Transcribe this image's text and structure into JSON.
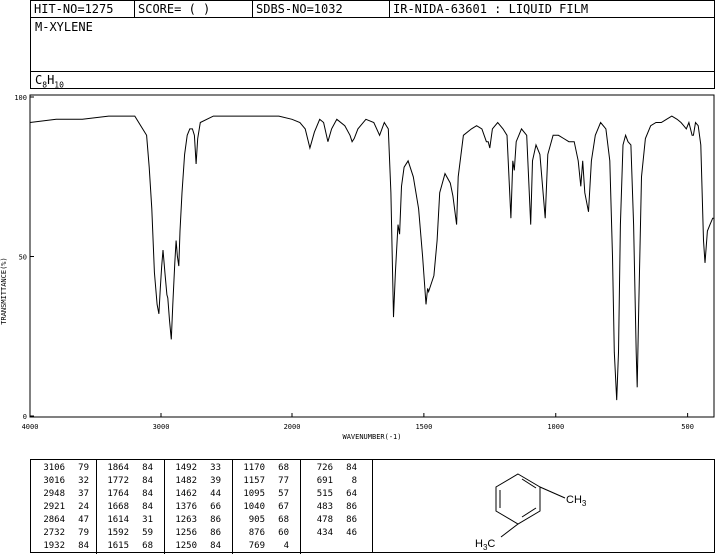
{
  "header": {
    "hit_no": "HIT-NO=1275",
    "score": "SCORE=  (   )",
    "sdbs_no": "SDBS-NO=1032",
    "ir_info": "IR-NIDA-63601 : LIQUID FILM"
  },
  "compound": {
    "name": "M-XYLENE",
    "formula_prefix_c": "C",
    "formula_c_count": "8",
    "formula_h": "H",
    "formula_h_count": "10"
  },
  "structure": {
    "ch3_top": "CH",
    "ch3_top_sub": "3",
    "ch3_bottom_h": "H",
    "ch3_bottom_sub": "3",
    "ch3_bottom_c": "C"
  },
  "peak_table": [
    [
      [
        "3106",
        "79"
      ],
      [
        "3016",
        "32"
      ],
      [
        "2948",
        "37"
      ],
      [
        "2921",
        "24"
      ],
      [
        "2864",
        "47"
      ],
      [
        "2732",
        "79"
      ],
      [
        "1932",
        "84"
      ]
    ],
    [
      [
        "1864",
        "84"
      ],
      [
        "1772",
        "84"
      ],
      [
        "1764",
        "84"
      ],
      [
        "1668",
        "84"
      ],
      [
        "1614",
        "31"
      ],
      [
        "1592",
        "59"
      ],
      [
        "1615",
        "68"
      ]
    ],
    [
      [
        "1492",
        "33"
      ],
      [
        "1482",
        "39"
      ],
      [
        "1462",
        "44"
      ],
      [
        "1376",
        "66"
      ],
      [
        "1263",
        "86"
      ],
      [
        "1256",
        "86"
      ],
      [
        "1250",
        "84"
      ]
    ],
    [
      [
        "1170",
        "68"
      ],
      [
        "1157",
        "77"
      ],
      [
        "1095",
        "57"
      ],
      [
        "1040",
        "67"
      ],
      [
        "905",
        "68"
      ],
      [
        "876",
        "60"
      ],
      [
        "769",
        "4"
      ]
    ],
    [
      [
        "726",
        "84"
      ],
      [
        "691",
        "8"
      ],
      [
        "515",
        "64"
      ],
      [
        "483",
        "86"
      ],
      [
        "478",
        "86"
      ],
      [
        "434",
        "46"
      ]
    ]
  ],
  "chart_data": {
    "type": "line",
    "title": "",
    "xlabel": "WAVENUMBER(-1)",
    "ylabel": "TRANSMITTANCE(%)",
    "xlim": [
      4000,
      400
    ],
    "ylim": [
      0,
      100
    ],
    "x_ticks": [
      4000,
      3000,
      2000,
      1500,
      1000,
      500
    ],
    "y_ticks": [
      0,
      50,
      100
    ],
    "x_tick_labels": [
      "4000",
      "3000",
      "2000",
      "1500",
      "1000",
      "500"
    ],
    "y_tick_labels": [
      "0",
      "50",
      "100"
    ],
    "grid": false,
    "series": [
      {
        "name": "",
        "points": [
          [
            4000,
            92
          ],
          [
            3800,
            93
          ],
          [
            3600,
            93
          ],
          [
            3400,
            94
          ],
          [
            3200,
            94
          ],
          [
            3110,
            88
          ],
          [
            3090,
            78
          ],
          [
            3070,
            65
          ],
          [
            3050,
            45
          ],
          [
            3030,
            35
          ],
          [
            3016,
            32
          ],
          [
            3005,
            40
          ],
          [
            2995,
            47
          ],
          [
            2985,
            52
          ],
          [
            2970,
            45
          ],
          [
            2955,
            38
          ],
          [
            2948,
            37
          ],
          [
            2935,
            30
          ],
          [
            2921,
            24
          ],
          [
            2910,
            35
          ],
          [
            2895,
            48
          ],
          [
            2885,
            55
          ],
          [
            2875,
            50
          ],
          [
            2864,
            47
          ],
          [
            2855,
            58
          ],
          [
            2840,
            70
          ],
          [
            2820,
            82
          ],
          [
            2800,
            88
          ],
          [
            2780,
            90
          ],
          [
            2760,
            90
          ],
          [
            2745,
            88
          ],
          [
            2732,
            79
          ],
          [
            2720,
            87
          ],
          [
            2700,
            92
          ],
          [
            2600,
            94
          ],
          [
            2400,
            94
          ],
          [
            2200,
            94
          ],
          [
            2100,
            94
          ],
          [
            2000,
            93
          ],
          [
            1970,
            92
          ],
          [
            1950,
            90
          ],
          [
            1932,
            84
          ],
          [
            1915,
            89
          ],
          [
            1895,
            93
          ],
          [
            1880,
            92
          ],
          [
            1864,
            86
          ],
          [
            1850,
            90
          ],
          [
            1830,
            93
          ],
          [
            1800,
            91
          ],
          [
            1780,
            88
          ],
          [
            1772,
            86
          ],
          [
            1764,
            87
          ],
          [
            1750,
            90
          ],
          [
            1720,
            93
          ],
          [
            1690,
            92
          ],
          [
            1668,
            88
          ],
          [
            1650,
            92
          ],
          [
            1635,
            90
          ],
          [
            1625,
            70
          ],
          [
            1615,
            31
          ],
          [
            1608,
            45
          ],
          [
            1598,
            60
          ],
          [
            1592,
            57
          ],
          [
            1585,
            72
          ],
          [
            1575,
            78
          ],
          [
            1560,
            80
          ],
          [
            1540,
            75
          ],
          [
            1520,
            65
          ],
          [
            1505,
            50
          ],
          [
            1492,
            35
          ],
          [
            1486,
            40
          ],
          [
            1482,
            39
          ],
          [
            1470,
            42
          ],
          [
            1462,
            44
          ],
          [
            1450,
            55
          ],
          [
            1440,
            70
          ],
          [
            1420,
            76
          ],
          [
            1400,
            73
          ],
          [
            1390,
            69
          ],
          [
            1376,
            60
          ],
          [
            1370,
            75
          ],
          [
            1350,
            88
          ],
          [
            1320,
            90
          ],
          [
            1300,
            91
          ],
          [
            1280,
            90
          ],
          [
            1263,
            86
          ],
          [
            1256,
            86
          ],
          [
            1250,
            84
          ],
          [
            1240,
            90
          ],
          [
            1220,
            92
          ],
          [
            1200,
            90
          ],
          [
            1185,
            88
          ],
          [
            1170,
            62
          ],
          [
            1163,
            80
          ],
          [
            1157,
            77
          ],
          [
            1150,
            86
          ],
          [
            1130,
            90
          ],
          [
            1110,
            88
          ],
          [
            1095,
            60
          ],
          [
            1088,
            80
          ],
          [
            1075,
            85
          ],
          [
            1060,
            82
          ],
          [
            1040,
            62
          ],
          [
            1030,
            82
          ],
          [
            1010,
            88
          ],
          [
            990,
            88
          ],
          [
            970,
            87
          ],
          [
            950,
            86
          ],
          [
            930,
            86
          ],
          [
            915,
            80
          ],
          [
            905,
            72
          ],
          [
            898,
            80
          ],
          [
            890,
            70
          ],
          [
            876,
            64
          ],
          [
            865,
            80
          ],
          [
            850,
            88
          ],
          [
            830,
            92
          ],
          [
            810,
            90
          ],
          [
            795,
            80
          ],
          [
            785,
            50
          ],
          [
            778,
            20
          ],
          [
            769,
            5
          ],
          [
            762,
            20
          ],
          [
            755,
            60
          ],
          [
            745,
            85
          ],
          [
            735,
            88
          ],
          [
            726,
            86
          ],
          [
            715,
            85
          ],
          [
            705,
            60
          ],
          [
            695,
            20
          ],
          [
            691,
            9
          ],
          [
            685,
            35
          ],
          [
            675,
            75
          ],
          [
            660,
            87
          ],
          [
            640,
            91
          ],
          [
            620,
            92
          ],
          [
            600,
            92
          ],
          [
            580,
            93
          ],
          [
            560,
            94
          ],
          [
            540,
            93
          ],
          [
            525,
            92
          ],
          [
            515,
            91
          ],
          [
            505,
            90
          ],
          [
            495,
            92
          ],
          [
            483,
            88
          ],
          [
            478,
            88
          ],
          [
            470,
            92
          ],
          [
            460,
            91
          ],
          [
            450,
            85
          ],
          [
            440,
            55
          ],
          [
            434,
            48
          ],
          [
            425,
            58
          ],
          [
            415,
            60
          ],
          [
            405,
            62
          ],
          [
            400,
            62
          ]
        ]
      }
    ]
  }
}
